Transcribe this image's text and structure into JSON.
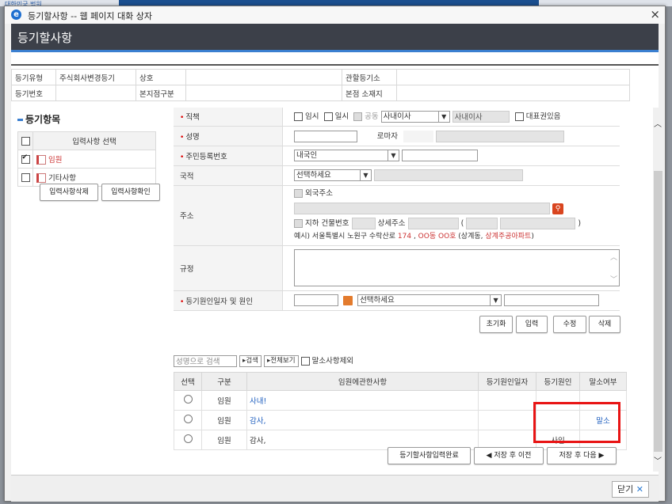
{
  "background": {
    "logo_text": "대한민국 법원"
  },
  "window": {
    "title": "등기할사항 -- 웹 페이지 대화 상자",
    "close_glyph": "×"
  },
  "header": {
    "title": "등기할사항"
  },
  "info": {
    "row1": [
      "등기유형",
      "주식회사변경등기",
      "상호",
      "",
      "관할등기소",
      ""
    ],
    "row2": [
      "등기번호",
      "",
      "본지점구분",
      "",
      "본점 소재지",
      ""
    ]
  },
  "left": {
    "section_title": "등기항목",
    "table_header": "입력사항 선택",
    "items": [
      {
        "label": "임원",
        "checked": true
      },
      {
        "label": "기타사항",
        "checked": false
      }
    ],
    "delete_button": "입력사항삭제",
    "confirm_button": "입력사항확인"
  },
  "form": {
    "position": {
      "label": "직책",
      "temp": "임시",
      "daily": "일시",
      "joint": "공동",
      "select_value": "사내이사",
      "display_value": "사내이사",
      "rep_label": "대표권있음"
    },
    "name": {
      "label": "성명",
      "roman_label": "로마자"
    },
    "rrn": {
      "label": "주민등록번호",
      "select_value": "내국인"
    },
    "nationality": {
      "label": "국적",
      "select_value": "선택하세요"
    },
    "address": {
      "label": "주소",
      "foreign_label": "외국주소",
      "underground": "지하",
      "building": "건물번호",
      "detail": "상세주소",
      "paren_open": "(",
      "paren_close": ")",
      "example_prefix": "예시) 서울특별시 노원구 수락산로 ",
      "example_num": "174",
      "example_sep": " , ",
      "example_dong": "OO동 OO호",
      "example_mid": " (상계동, ",
      "example_apt": "상계주공아파트",
      "example_end": ")"
    },
    "rule": {
      "label": "규정"
    },
    "cause": {
      "label": "등기원인일자 및 원인",
      "select_value": "선택하세요"
    }
  },
  "actions": {
    "reset": "초기화",
    "input": "입력",
    "edit": "수정",
    "delete": "삭제"
  },
  "search": {
    "placeholder": "성명으로 검색",
    "search_btn": "검색",
    "all_btn": "전체보기",
    "exclude_label": "말소사항제외"
  },
  "result": {
    "headers": [
      "선택",
      "구분",
      "임원에관한사항",
      "등기원인일자",
      "등기원인",
      "말소여부"
    ],
    "rows": [
      {
        "type": "임원",
        "desc": "사내!",
        "date": "",
        "cause": "",
        "cancel": ""
      },
      {
        "type": "임원",
        "desc": "감사,",
        "date": "",
        "cause": "",
        "cancel": "말소"
      },
      {
        "type": "임원",
        "desc": "감사,",
        "date": "",
        "cause": "사임",
        "cancel": ""
      }
    ]
  },
  "bottom": {
    "complete": "등기할사항입력완료",
    "save_prev": "저장 후 이전",
    "save_next": "저장 후 다음"
  },
  "footer": {
    "close": "닫기"
  }
}
